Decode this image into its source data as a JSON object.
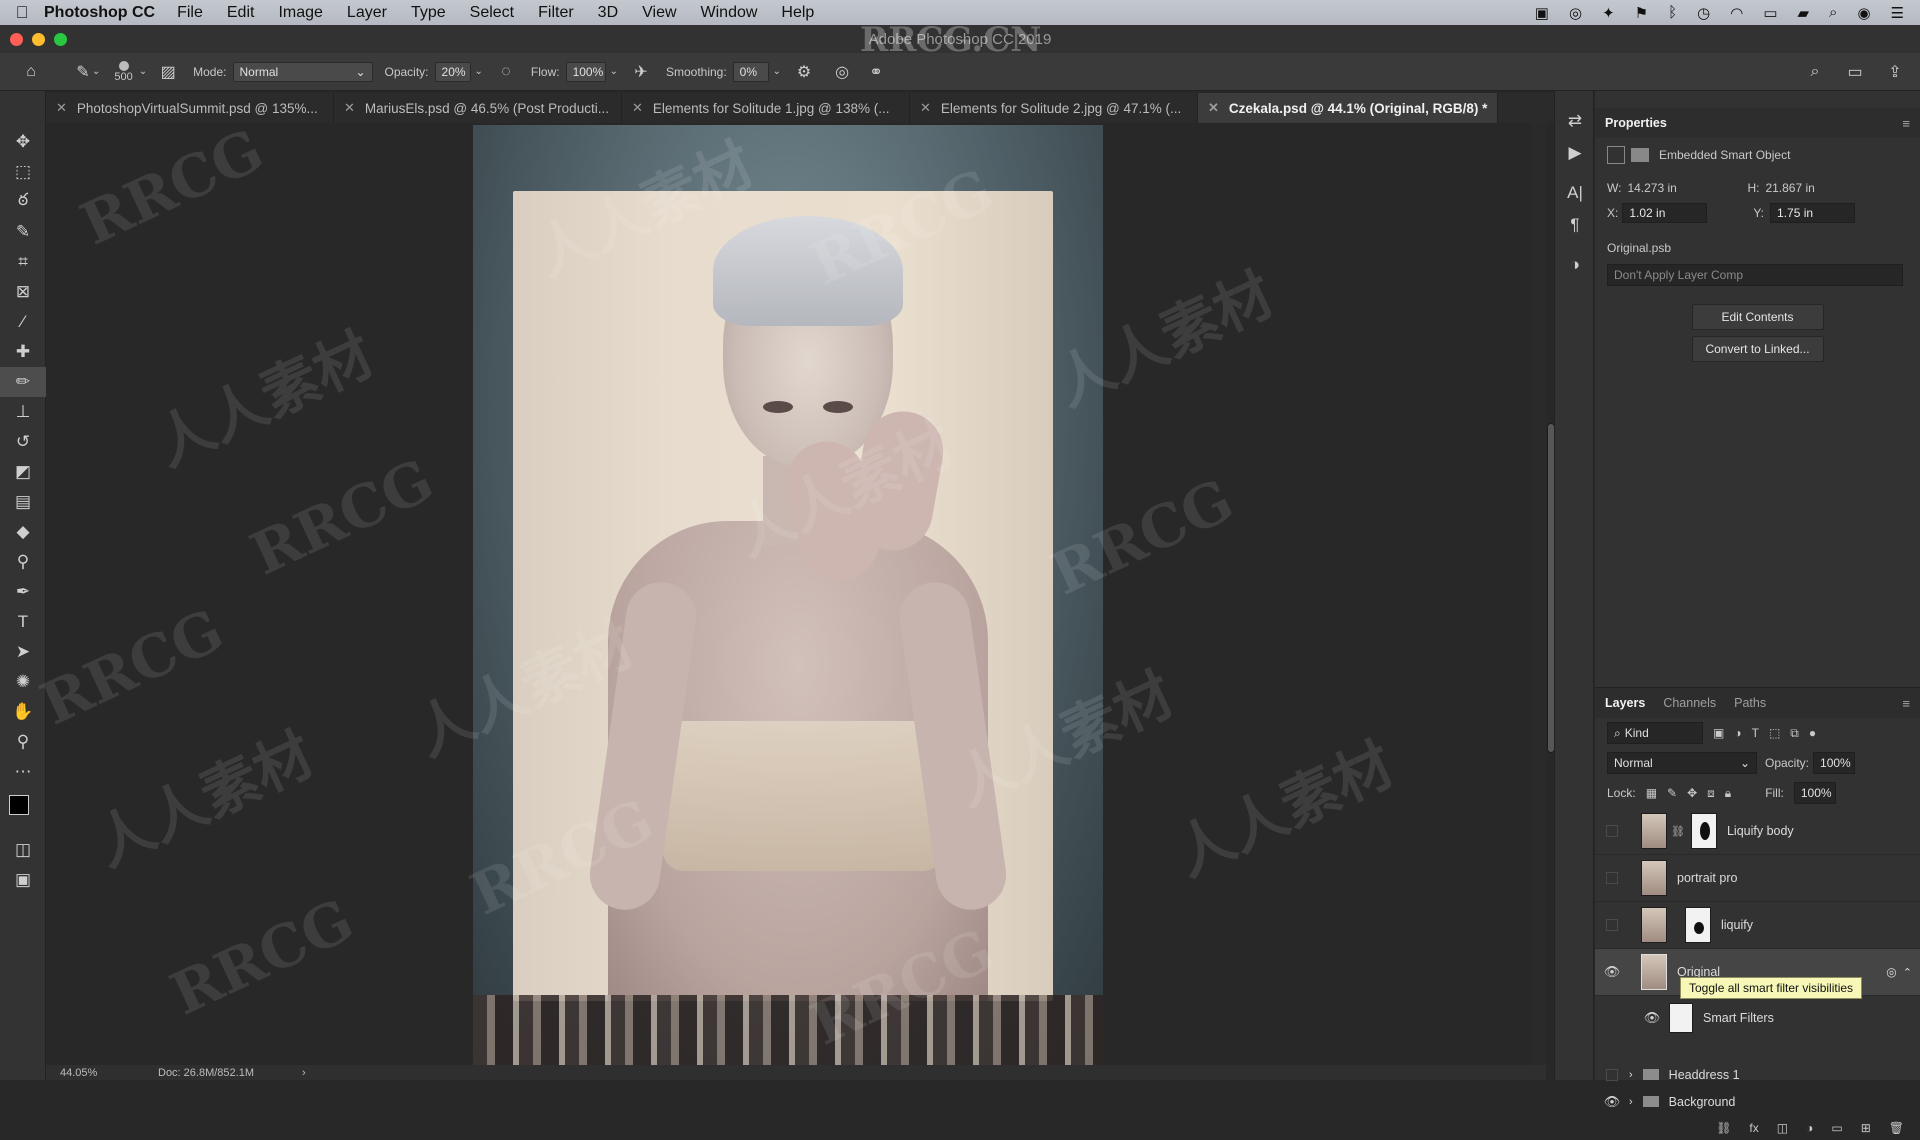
{
  "menubar": {
    "app_name": "Photoshop CC",
    "items": [
      "File",
      "Edit",
      "Image",
      "Layer",
      "Type",
      "Select",
      "Filter",
      "3D",
      "View",
      "Window",
      "Help"
    ]
  },
  "titlebar": {
    "title": "Adobe Photoshop CC 2019"
  },
  "options": {
    "brush_size": "500",
    "mode_label": "Mode:",
    "mode_value": "Normal",
    "opacity_label": "Opacity:",
    "opacity_value": "20%",
    "flow_label": "Flow:",
    "flow_value": "100%",
    "smoothing_label": "Smoothing:",
    "smoothing_value": "0%"
  },
  "tabs": [
    "PhotoshopVirtualSummit.psd @ 135%...",
    "MariusEls.psd @ 46.5% (Post Producti...",
    "Elements for Solitude 1.jpg @ 138% (...",
    "Elements for Solitude 2.jpg @ 47.1% (...",
    "Czekala.psd @ 44.1% (Original, RGB/8) *"
  ],
  "status": {
    "zoom": "44.05%",
    "doc": "Doc: 26.8M/852.1M"
  },
  "properties": {
    "title": "Properties",
    "object_type": "Embedded Smart Object",
    "w_label": "W:",
    "w_value": "14.273 in",
    "h_label": "H:",
    "h_value": "21.867 in",
    "x_label": "X:",
    "x_value": "1.02 in",
    "y_label": "Y:",
    "y_value": "1.75 in",
    "file_name": "Original.psb",
    "layer_comp": "Don't Apply Layer Comp",
    "edit_contents": "Edit Contents",
    "convert_linked": "Convert to Linked..."
  },
  "layers_panel": {
    "tabs": [
      "Layers",
      "Channels",
      "Paths"
    ],
    "filter_kind": "Kind",
    "blend_mode": "Normal",
    "opacity_label": "Opacity:",
    "opacity_value": "100%",
    "lock_label": "Lock:",
    "fill_label": "Fill:",
    "fill_value": "100%",
    "layers": [
      "Liquify body",
      "portrait pro",
      "liquify",
      "Original",
      "Smart Filters",
      "Headdress 1",
      "Background"
    ],
    "tooltip": "Toggle all smart filter visibilities"
  },
  "watermarks": [
    "RRCG",
    "人人素材",
    "RRCG.CN"
  ]
}
